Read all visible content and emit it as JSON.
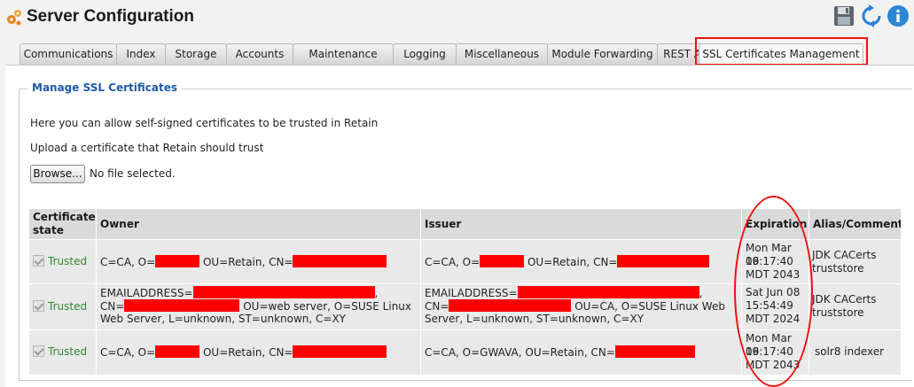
{
  "header": {
    "title": "Server Configuration"
  },
  "tabs": [
    {
      "label": "Communications",
      "active": false
    },
    {
      "label": "Index",
      "active": false
    },
    {
      "label": "Storage",
      "active": false
    },
    {
      "label": "Accounts",
      "active": false
    },
    {
      "label": "Maintenance",
      "active": false
    },
    {
      "label": "Logging",
      "active": false
    },
    {
      "label": "Miscellaneous",
      "active": false
    },
    {
      "label": "Module Forwarding",
      "active": false
    },
    {
      "label": "REST API",
      "active": false
    },
    {
      "label": "SSL Certificates Management",
      "active": true
    }
  ],
  "section": {
    "legend": "Manage SSL Certificates",
    "description": "Here you can allow self-signed certificates to be trusted in Retain",
    "upload_label": "Upload a certificate that Retain should trust",
    "browse_label": "Browse...",
    "file_status": "No file selected."
  },
  "table": {
    "headers": {
      "state_line1": "Certificate",
      "state_line2": "state",
      "owner": "Owner",
      "issuer": "Issuer",
      "expiration": "Expiration",
      "alias": "Alias/Comment"
    },
    "rows": [
      {
        "state": "Trusted",
        "owner_l1_a": "C=CA, O=",
        "owner_l1_b": " OU=Retain, CN=",
        "issuer_l1_a": "C=CA, O=",
        "issuer_l1_b": " OU=Retain, CN=",
        "exp_day": "Mon Mar 16",
        "exp_time": "09:17:40",
        "exp_tz": "MDT 2043",
        "alias_l1": "JDK CACerts",
        "alias_l2": "truststore"
      },
      {
        "state": "Trusted",
        "owner_l1": "EMAILADDRESS=",
        "owner_l1_end": ",",
        "owner_l2_a": "CN=",
        "owner_l2_b": " OU=web server, O=SUSE Linux",
        "owner_l3": "Web Server, L=unknown, ST=unknown, C=XY",
        "issuer_l1": "EMAILADDRESS=",
        "issuer_l1_end": ",",
        "issuer_l2_a": "CN=",
        "issuer_l2_b": " OU=CA, O=SUSE Linux Web",
        "issuer_l3": "Server, L=unknown, ST=unknown, C=XY",
        "exp_day": "Sat Jun 08",
        "exp_time": "15:54:49",
        "exp_tz": "MDT 2024",
        "alias_l1": "JDK CACerts",
        "alias_l2": "truststore"
      },
      {
        "state": "Trusted",
        "owner_l1_a": "C=CA, O=",
        "owner_l1_b": " OU=Retain, CN=",
        "issuer_l1_a": "C=CA, O=GWAVA, OU=Retain, CN=",
        "exp_day": "Mon Mar 16",
        "exp_time": "09:17:40",
        "exp_tz": "MDT 2043",
        "alias_l1": "solr8 indexer"
      }
    ]
  },
  "icons": {
    "app": "gears-icon",
    "save": "floppy-disk-icon",
    "refresh": "refresh-icon",
    "info": "info-icon"
  },
  "colors": {
    "accent_blue": "#1d5aa8",
    "trusted_green": "#2f8a2f",
    "highlight_red": "#e11111",
    "redaction_red": "#ff0000"
  }
}
